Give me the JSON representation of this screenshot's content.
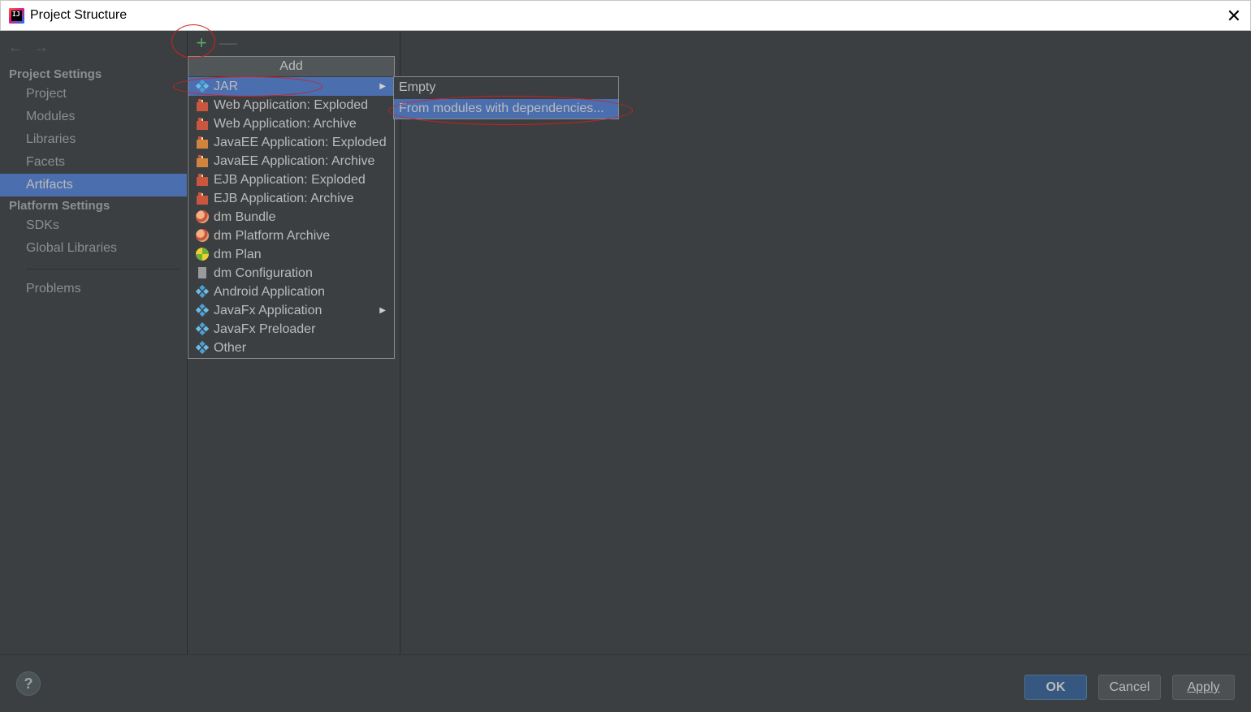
{
  "window": {
    "title": "Project Structure",
    "close_label": "✕"
  },
  "nav": {
    "back_icon": "←",
    "forward_icon": "→"
  },
  "sidebar": {
    "project_settings_title": "Project Settings",
    "platform_settings_title": "Platform Settings",
    "items": [
      {
        "label": "Project"
      },
      {
        "label": "Modules"
      },
      {
        "label": "Libraries"
      },
      {
        "label": "Facets"
      },
      {
        "label": "Artifacts",
        "selected": true
      },
      {
        "label": "SDKs"
      },
      {
        "label": "Global Libraries"
      },
      {
        "label": "Problems"
      }
    ]
  },
  "toolbar": {
    "add_label": "+",
    "remove_label": "—"
  },
  "popup": {
    "title": "Add",
    "items": [
      {
        "label": "JAR",
        "icon": "jar-icon",
        "has_submenu": true,
        "highlighted": true
      },
      {
        "label": "Web Application: Exploded",
        "icon": "gift-icon"
      },
      {
        "label": "Web Application: Archive",
        "icon": "gift-icon"
      },
      {
        "label": "JavaEE Application: Exploded",
        "icon": "gift-icon"
      },
      {
        "label": "JavaEE Application: Archive",
        "icon": "gift-icon"
      },
      {
        "label": "EJB Application: Exploded",
        "icon": "gift-icon"
      },
      {
        "label": "EJB Application: Archive",
        "icon": "gift-icon"
      },
      {
        "label": "dm Bundle",
        "icon": "bundle-icon"
      },
      {
        "label": "dm Platform Archive",
        "icon": "bundle-icon"
      },
      {
        "label": "dm Plan",
        "icon": "plan-icon"
      },
      {
        "label": "dm Configuration",
        "icon": "config-icon"
      },
      {
        "label": "Android Application",
        "icon": "jar-icon"
      },
      {
        "label": "JavaFx Application",
        "icon": "jar-icon",
        "has_submenu": true
      },
      {
        "label": "JavaFx Preloader",
        "icon": "jar-icon"
      },
      {
        "label": "Other",
        "icon": "jar-icon"
      }
    ],
    "submenu_arrow": "▶"
  },
  "submenu": {
    "items": [
      {
        "label": "Empty"
      },
      {
        "label": "From modules with dependencies...",
        "highlighted": true
      }
    ]
  },
  "buttons": {
    "help": "?",
    "ok": "OK",
    "cancel": "Cancel",
    "apply": "Apply"
  },
  "colors": {
    "background": "#3c3f41",
    "selection": "#4b6eaf",
    "annotation": "#d02020",
    "add_green": "#59a869"
  }
}
